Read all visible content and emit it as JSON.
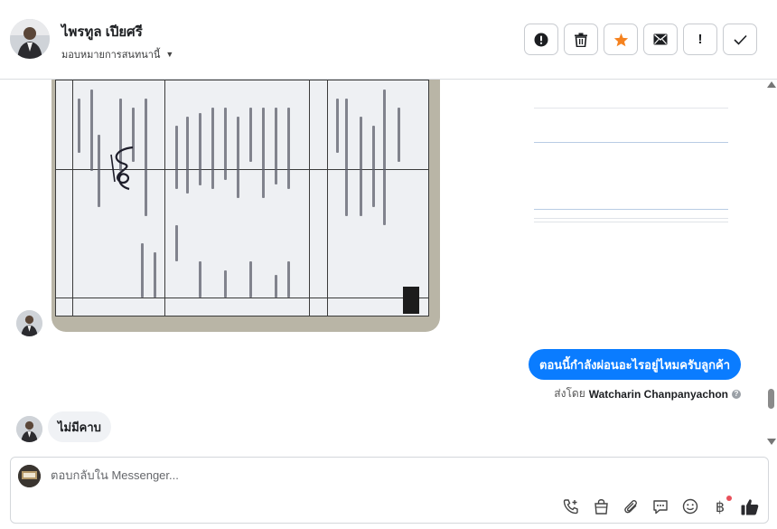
{
  "header": {
    "contact_name": "ไพรทูล เปียศรี",
    "assign_label": "มอบหมายการสนทนานี้",
    "toolbar": [
      {
        "name": "report-button",
        "icon": "alert-circle-icon"
      },
      {
        "name": "delete-button",
        "icon": "trash-icon"
      },
      {
        "name": "star-button",
        "icon": "star-icon",
        "color": "#f5821f"
      },
      {
        "name": "mark-unread-button",
        "icon": "envelope-icon"
      },
      {
        "name": "follow-up-button",
        "icon": "exclamation-icon",
        "label": "!"
      },
      {
        "name": "mark-done-button",
        "icon": "checkmark-icon"
      }
    ]
  },
  "messages": {
    "outgoing_text": "ตอนนี้กำลังผ่อนอะไรอยู่ไหมครับลูกค้า",
    "sent_by_prefix": "ส่งโดย",
    "sent_by_name": "Watcharin Chanpanyachon",
    "incoming_text": "ไม่มีคาบ"
  },
  "composer": {
    "placeholder": "ตอบกลับใน Messenger...",
    "actions": [
      "phone-plus-icon",
      "shopping-bag-icon",
      "paperclip-icon",
      "chat-icon",
      "emoji-icon",
      "baht-icon",
      "thumbs-up-icon"
    ]
  },
  "colors": {
    "accent": "#0a7cff",
    "incoming_bubble": "#f0f2f5",
    "star": "#f5821f",
    "notification_dot": "#e8505b"
  }
}
